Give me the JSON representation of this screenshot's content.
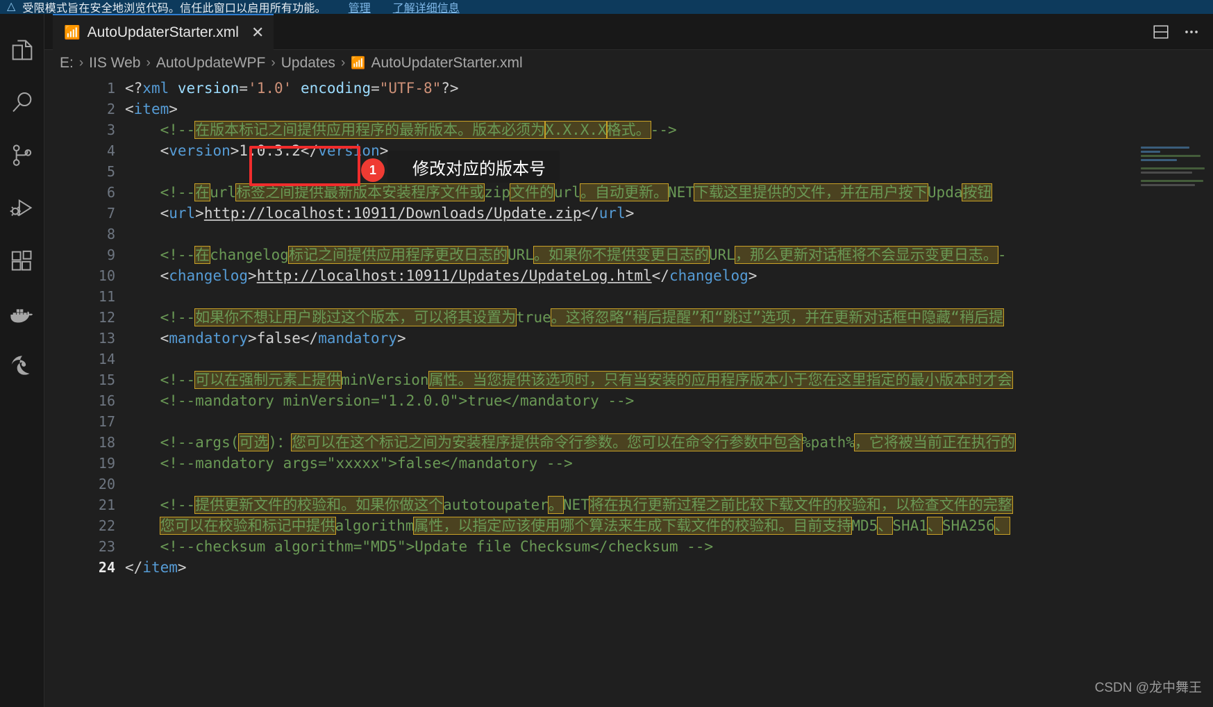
{
  "notification": {
    "icon": "shield-icon",
    "text": "受限模式旨在安全地浏览代码。信任此窗口以启用所有功能。",
    "link_manage": "管理",
    "link_learn": "了解详细信息"
  },
  "activity_bar": {
    "items": [
      {
        "name": "explorer-icon",
        "label": "资源管理器"
      },
      {
        "name": "search-icon",
        "label": "搜索"
      },
      {
        "name": "source-control-icon",
        "label": "源代码管理"
      },
      {
        "name": "run-debug-icon",
        "label": "运行和调试"
      },
      {
        "name": "extensions-icon",
        "label": "扩展"
      },
      {
        "name": "docker-icon",
        "label": "Docker"
      },
      {
        "name": "edge-tools-icon",
        "label": "Microsoft Edge Tools"
      }
    ]
  },
  "tab": {
    "icon": "xml-file-icon",
    "label": "AutoUpdaterStarter.xml",
    "close": "✕",
    "actions": [
      "split-editor-icon",
      "more-actions-icon"
    ]
  },
  "breadcrumb": {
    "separator": "›",
    "items": [
      "E:",
      "IIS Web",
      "AutoUpdateWPF",
      "Updates",
      "AutoUpdaterStarter.xml"
    ],
    "file_icon": "xml-file-icon"
  },
  "annotation": {
    "badge": "1",
    "text": "修改对应的版本号",
    "highlight_color": "#f02c2c"
  },
  "watermark": "CSDN @龙中舞王",
  "editor": {
    "line_numbers": [
      1,
      2,
      3,
      4,
      5,
      6,
      7,
      8,
      9,
      10,
      11,
      12,
      13,
      14,
      15,
      16,
      17,
      18,
      19,
      20,
      21,
      22,
      23,
      24
    ],
    "current_line": 24,
    "lines": [
      {
        "n": 1,
        "type": "decl",
        "text": "<?xml version='1.0' encoding=\"UTF-8\"?>"
      },
      {
        "n": 2,
        "type": "tag",
        "text": "<item>"
      },
      {
        "n": 3,
        "type": "comment",
        "text": "<!--在版本标记之间提供应用程序的最新版本。版本必须为X.X.X.X格式。-->"
      },
      {
        "n": 4,
        "type": "element",
        "text": "<version>1.0.3.2</version>",
        "tag": "version",
        "value": "1.0.3.2"
      },
      {
        "n": 5,
        "type": "blank",
        "text": ""
      },
      {
        "n": 6,
        "type": "comment",
        "text": "<!--在url标签之间提供最新版本安装程序文件或zip文件的url。自动更新。NET下载这里提供的文件，并在用户按下Update按钮"
      },
      {
        "n": 7,
        "type": "element",
        "text": "<url>http://localhost:10911/Downloads/Update.zip</url>",
        "tag": "url",
        "value": "http://localhost:10911/Downloads/Update.zip"
      },
      {
        "n": 8,
        "type": "blank",
        "text": ""
      },
      {
        "n": 9,
        "type": "comment",
        "text": "<!--在changelog标记之间提供应用程序更改日志的URL。如果你不提供变更日志的URL，那么更新对话框将不会显示变更日志。-"
      },
      {
        "n": 10,
        "type": "element",
        "text": "<changelog>http://localhost:10911/Updates/UpdateLog.html</changelog>",
        "tag": "changelog",
        "value": "http://localhost:10911/Updates/UpdateLog.html"
      },
      {
        "n": 11,
        "type": "blank",
        "text": ""
      },
      {
        "n": 12,
        "type": "comment",
        "text": "<!--如果你不想让用户跳过这个版本，可以将其设置为true。这将忽略\"稍后提醒\"和\"跳过\"选项，并在更新对话框中隐藏\"稍后提"
      },
      {
        "n": 13,
        "type": "element",
        "text": "<mandatory>false</mandatory>",
        "tag": "mandatory",
        "value": "false"
      },
      {
        "n": 14,
        "type": "blank",
        "text": ""
      },
      {
        "n": 15,
        "type": "comment",
        "text": "<!--可以在强制元素上提供minVersion属性。当您提供该选项时，只有当安装的应用程序版本小于您在这里指定的最小版本时才会"
      },
      {
        "n": 16,
        "type": "comment",
        "text": "<!--mandatory minVersion=\"1.2.0.0\">true</mandatory -->"
      },
      {
        "n": 17,
        "type": "blank",
        "text": ""
      },
      {
        "n": 18,
        "type": "comment",
        "text": "<!--args(可选)：您可以在这个标记之间为安装程序提供命令行参数。您可以在命令行参数中包含%path%，它将被当前正在执行的"
      },
      {
        "n": 19,
        "type": "comment",
        "text": "<!--mandatory args=\"xxxxx\">false</mandatory -->"
      },
      {
        "n": 20,
        "type": "blank",
        "text": ""
      },
      {
        "n": 21,
        "type": "comment",
        "text": "<!--提供更新文件的校验和。如果你做这个autotoupater。NET将在执行更新过程之前比较下载文件的校验和，以检查文件的完整"
      },
      {
        "n": 22,
        "type": "comment",
        "text": "您可以在校验和标记中提供algorithm属性，以指定应该使用哪个算法来生成下载文件的校验和。目前支持MD5、SHA1、SHA256、"
      },
      {
        "n": 23,
        "type": "comment",
        "text": "<!--checksum algorithm=\"MD5\">Update file Checksum</checksum -->"
      },
      {
        "n": 24,
        "type": "tag",
        "text": "</item>"
      }
    ]
  },
  "colors": {
    "editor_bg": "#1f1f1f",
    "sidebar_bg": "#181818",
    "banner_bg": "#0d3a5c",
    "tag": "#569cd6",
    "comment": "#6a9955",
    "string": "#ce9178",
    "attr": "#9cdcfe",
    "highlight_box": "#c9a227",
    "accent_red": "#f02c2c"
  }
}
